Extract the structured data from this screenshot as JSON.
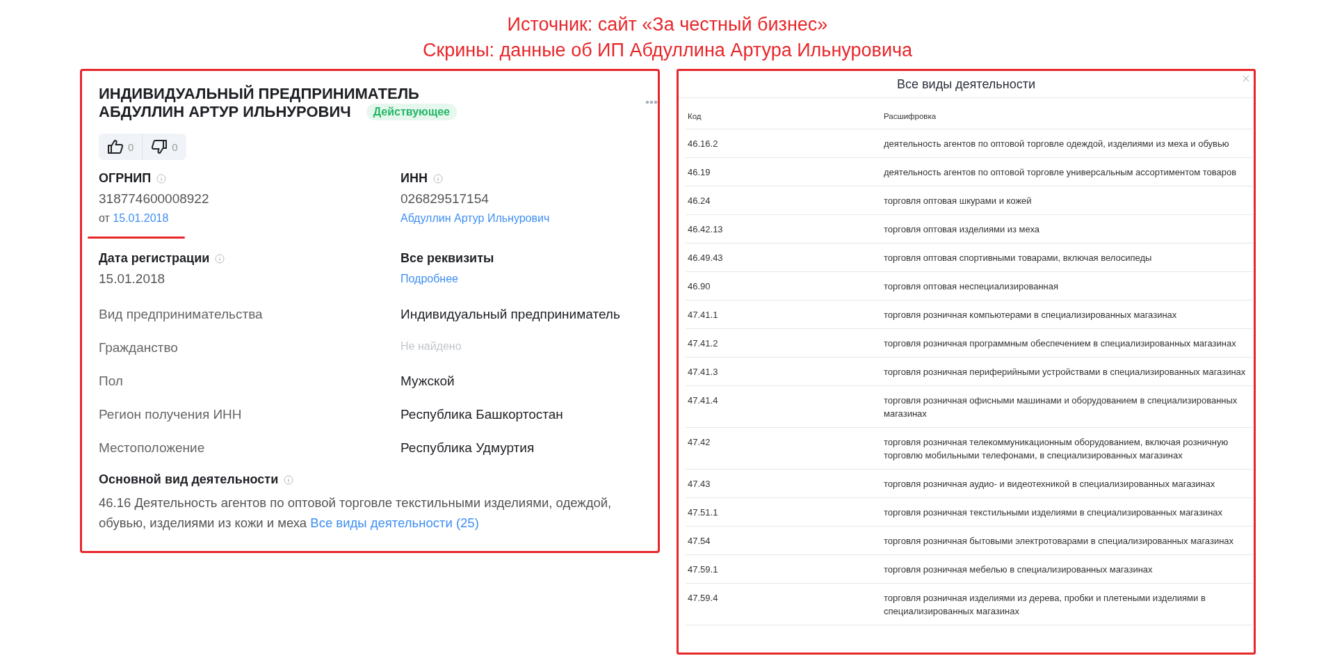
{
  "caption": {
    "lines": [
      "Источник: сайт «За честный бизнес»",
      "Скрины: данные об ИП Абдуллина Артура Ильнуровича"
    ]
  },
  "card": {
    "title_lines": [
      "ИНДИВИДУАЛЬНЫЙ ПРЕДПРИНИМАТЕЛЬ",
      "АБДУЛЛИН АРТУР ИЛЬНУРОВИЧ"
    ],
    "status": "Действующее",
    "likes": "0",
    "dislikes": "0",
    "ogrnip": {
      "label": "ОГРНИП",
      "value": "318774600008922",
      "date_prefix": "от",
      "date": "15.01.2018",
      "underlined": true
    },
    "inn": {
      "label": "ИНН",
      "value": "026829517154",
      "owner": "Абдуллин Артур Ильнурович"
    },
    "registration": {
      "label": "Дата регистрации",
      "value": "15.01.2018"
    },
    "requisites": {
      "label": "Все реквизиты",
      "link": "Подробнее"
    },
    "fields": [
      {
        "label": "Вид предпринимательства",
        "value": "Индивидуальный предприниматель",
        "not_found": false
      },
      {
        "label": "Гражданство",
        "value": "Не найдено",
        "not_found": true
      },
      {
        "label": "Пол",
        "value": "Мужской",
        "not_found": false
      },
      {
        "label": "Регион получения ИНН",
        "value": "Республика Башкортостан",
        "not_found": false
      },
      {
        "label": "Местоположение",
        "value": "Республика Удмуртия",
        "not_found": false
      }
    ],
    "main_activity": {
      "label": "Основной вид деятельности",
      "text": "46.16 Деятельность агентов по оптовой торговле текстильными изделиями, одеждой, обувью, изделиями из кожи и меха",
      "link": "Все виды деятельности (25)"
    }
  },
  "modal": {
    "title": "Все виды деятельности",
    "columns": [
      "Код",
      "Расшифровка"
    ],
    "rows": [
      {
        "code": "46.16.2",
        "text": "деятельность агентов по оптовой торговле одеждой, изделиями из меха и обувью"
      },
      {
        "code": "46.19",
        "text": "деятельность агентов по оптовой торговле универсальным ассортиментом товаров"
      },
      {
        "code": "46.24",
        "text": "торговля оптовая шкурами и кожей"
      },
      {
        "code": "46.42.13",
        "text": "торговля оптовая изделиями из меха"
      },
      {
        "code": "46.49.43",
        "text": "торговля оптовая спортивными товарами, включая велосипеды"
      },
      {
        "code": "46.90",
        "text": "торговля оптовая неспециализированная"
      },
      {
        "code": "47.41.1",
        "text": "торговля розничная компьютерами в специализированных магазинах"
      },
      {
        "code": "47.41.2",
        "text": "торговля розничная программным обеспечением в специализированных магазинах"
      },
      {
        "code": "47.41.3",
        "text": "торговля розничная периферийными устройствами в специализированных магазинах"
      },
      {
        "code": "47.41.4",
        "text": "торговля розничная офисными машинами и оборудованием в специализированных магазинах"
      },
      {
        "code": "47.42",
        "text": "торговля розничная телекоммуникационным оборудованием, включая розничную торговлю мобильными телефонами, в специализированных магазинах"
      },
      {
        "code": "47.43",
        "text": "торговля розничная аудио- и видеотехникой в специализированных магазинах"
      },
      {
        "code": "47.51.1",
        "text": "торговля розничная текстильными изделиями в специализированных магазинах"
      },
      {
        "code": "47.54",
        "text": "торговля розничная бытовыми электротоварами в специализированных магазинах"
      },
      {
        "code": "47.59.1",
        "text": "торговля розничная мебелью в специализированных магазинах"
      },
      {
        "code": "47.59.4",
        "text": "торговля розничная изделиями из дерева, пробки и плетеными изделиями в специализированных магазинах"
      }
    ]
  }
}
